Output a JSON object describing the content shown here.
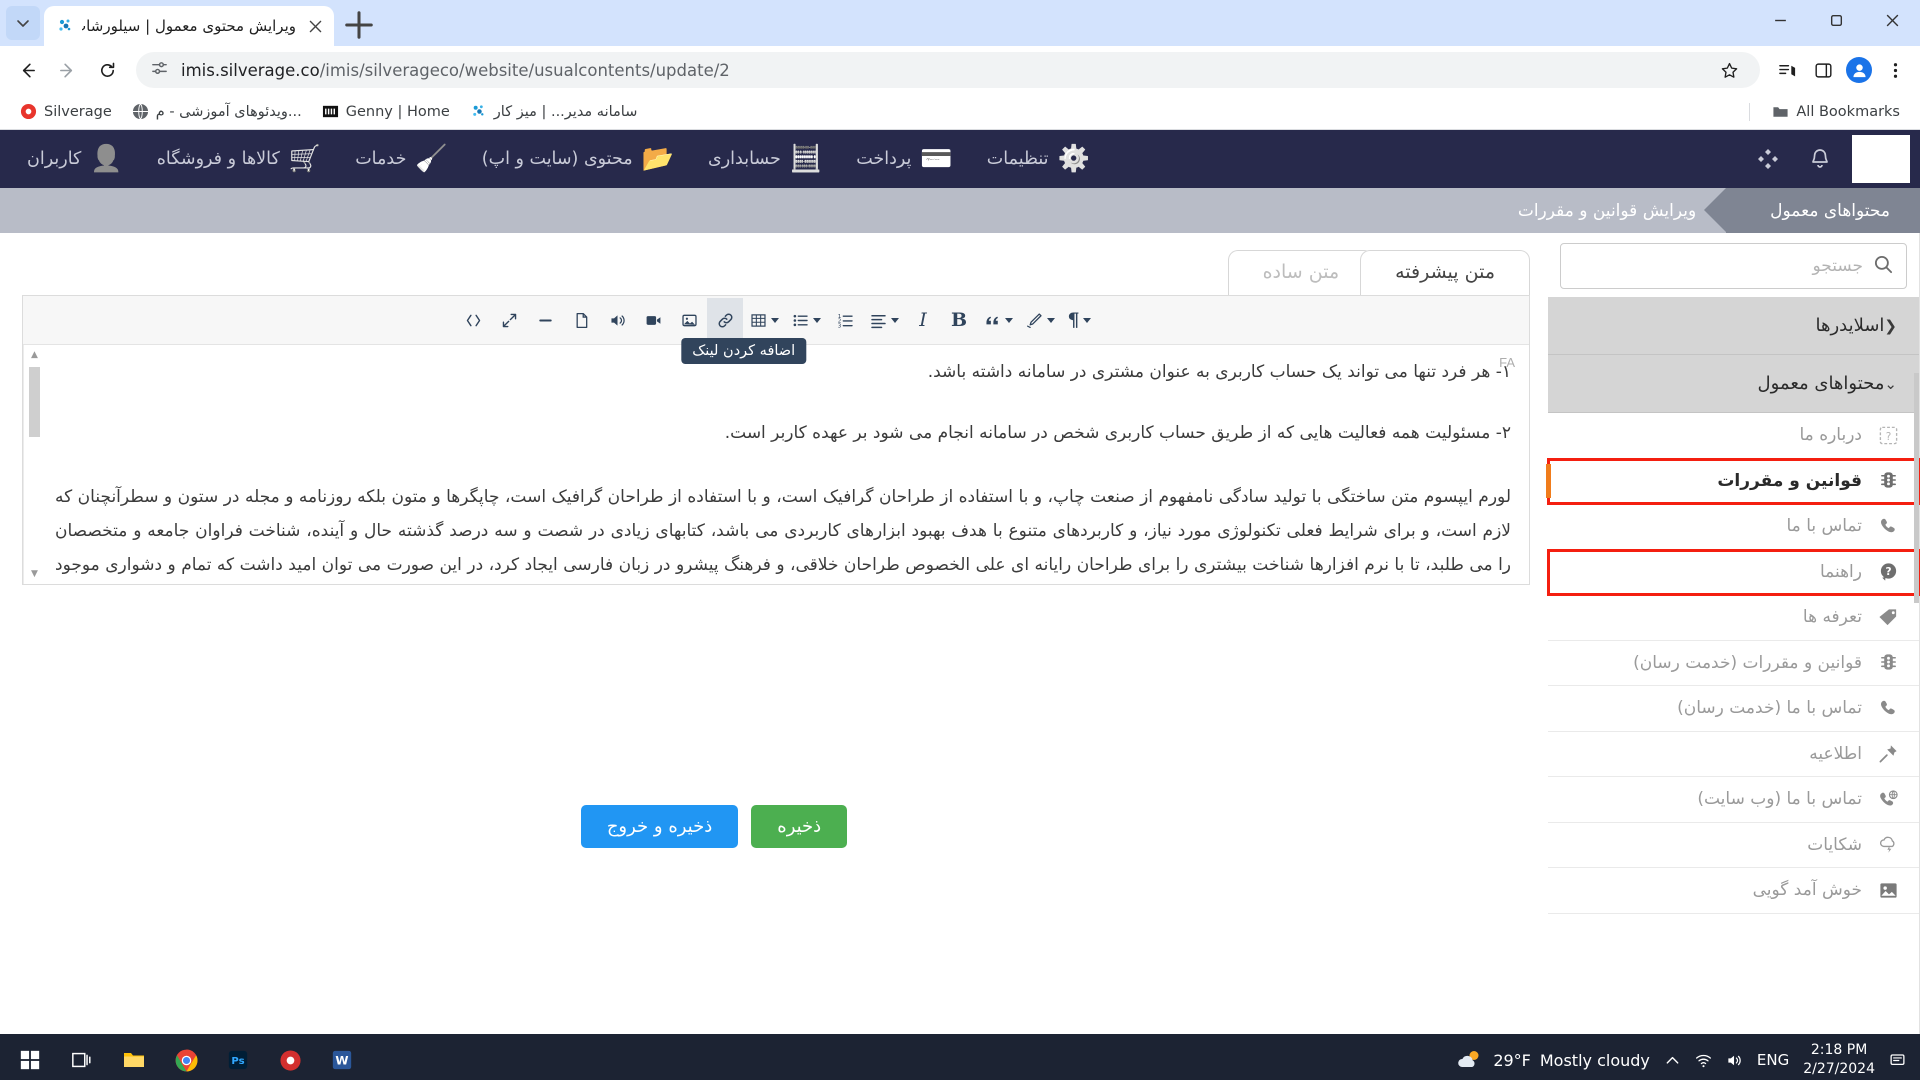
{
  "browser": {
    "tab": {
      "title": "ویرایش محتوی معمول | سیلورشاپ",
      "favicon_name": "silverage-favicon"
    },
    "new_tab_label": "+",
    "url_host": "imis.silverage.co",
    "url_path": "/imis/silverageco/website/usualcontents/update/2",
    "bookmarks": [
      {
        "label": "Silverage",
        "icon": "record-icon"
      },
      {
        "label": "ویدئوهای آموزشی - م...",
        "icon": "globe-icon"
      },
      {
        "label": "Genny | Home",
        "icon": "genny-icon"
      },
      {
        "label": "سامانه مدیر... | میز کار",
        "icon": "silverage-favicon"
      }
    ],
    "all_bookmarks_label": "All Bookmarks"
  },
  "appbar": {
    "menu": [
      {
        "label": "کاربران",
        "icon": "user-icon"
      },
      {
        "label": "کالاها و فروشگاه",
        "icon": "cart-icon"
      },
      {
        "label": "خدمات",
        "icon": "broom-icon"
      },
      {
        "label": "محتوی (سایت و اپ)",
        "icon": "folder-icon",
        "active": true
      },
      {
        "label": "حسابداری",
        "icon": "calculator-icon"
      },
      {
        "label": "پرداخت",
        "icon": "card-icon"
      },
      {
        "label": "تنظیمات",
        "icon": "gears-icon"
      }
    ],
    "bell_icon": "bell-icon",
    "apps_icon": "diamond-grid-icon"
  },
  "breadcrumbs": [
    {
      "label": "محتواهای معمول",
      "style": "dark"
    },
    {
      "label": "ویرایش قوانین و مقررات",
      "style": "light"
    }
  ],
  "editor": {
    "tabs": [
      {
        "label": "متن پیشرفته",
        "active": true
      },
      {
        "label": "متن ساده",
        "active": false
      }
    ],
    "toolbar": [
      {
        "name": "code-view-icon",
        "tooltip": ""
      },
      {
        "name": "fullscreen-icon",
        "tooltip": ""
      },
      {
        "name": "horizontal-rule-icon",
        "tooltip": ""
      },
      {
        "name": "file-icon",
        "tooltip": ""
      },
      {
        "name": "audio-icon",
        "tooltip": ""
      },
      {
        "name": "video-icon",
        "tooltip": ""
      },
      {
        "name": "image-icon",
        "tooltip": ""
      },
      {
        "name": "link-icon",
        "tooltip": "اضافه کردن لینک",
        "active": true
      },
      {
        "name": "table-icon",
        "caret": true
      },
      {
        "name": "unordered-list-icon",
        "caret": true
      },
      {
        "name": "ordered-list-icon",
        "caret": false
      },
      {
        "name": "align-icon",
        "caret": true
      },
      {
        "name": "italic-icon",
        "label": "I"
      },
      {
        "name": "bold-icon",
        "label": "B"
      },
      {
        "name": "quote-icon",
        "label": "““",
        "caret": true
      },
      {
        "name": "format-painter-icon",
        "caret": true
      },
      {
        "name": "paragraph-icon",
        "label": "¶",
        "caret": true
      }
    ],
    "lang_badge": "FA",
    "content": [
      "۱- هر فرد تنها می تواند یک حساب کاربری به عنوان مشتری در سامانه داشته باشد.",
      "۲- مسئولیت همه فعالیت هایی که از طریق حساب کاربری شخص در سامانه انجام می شود بر عهده کاربر است.",
      "لورم ایپسوم متن ساختگی با تولید سادگی نامفهوم از صنعت چاپ، و با استفاده از طراحان گرافیک است، و با استفاده از طراحان گرافیک است، چاپگرها و متون بلکه روزنامه و مجله در ستون و سطرآنچنان که لازم است، و برای شرایط فعلی تکنولوژی مورد نیاز، و کاربردهای متنوع با هدف بهبود ابزارهای کاربردی می باشد، کتابهای زیادی در شصت و سه درصد گذشته حال و آینده، شناخت فراوان جامعه و متخصصان را می طلبد، تا با نرم افزارها شناخت بیشتری را برای طراحان رایانه ای علی الخصوص طراحان خلاقی، و فرهنگ پیشرو در زبان فارسی ایجاد کرد، در این صورت می توان امید داشت که تمام و دشواری موجود در ارائه راهکارها، و شرایط"
    ]
  },
  "actions": {
    "save_label": "ذخیره",
    "save_exit_label": "ذخیره و خروج",
    "save_color": "#4caf50",
    "save_exit_color": "#2196f3"
  },
  "sidepanel": {
    "search_placeholder": "جستجو",
    "search_value": "",
    "search_icon": "search-icon",
    "groups": [
      {
        "label": "اسلایدرها",
        "chevron": "left",
        "expanded": false
      },
      {
        "label": "محتواهای معمول",
        "chevron": "down",
        "expanded": true
      }
    ],
    "items": [
      {
        "label": "درباره ما",
        "icon": "question-box-icon",
        "highlight": false
      },
      {
        "label": "قوانین و مقررات",
        "icon": "traffic-light-icon",
        "highlight": true,
        "active": true
      },
      {
        "label": "تماس با ما",
        "icon": "phone-icon",
        "highlight": false
      },
      {
        "label": "راهنما",
        "icon": "help-circle-icon",
        "highlight": true
      },
      {
        "label": "تعرفه ها",
        "icon": "tag-icon",
        "highlight": false
      },
      {
        "label": "قوانین و مقررات (خدمت رسان)",
        "icon": "traffic-light-icon",
        "highlight": false
      },
      {
        "label": "تماس با ما (خدمت رسان)",
        "icon": "phone-icon",
        "highlight": false
      },
      {
        "label": "اطلاعیه",
        "icon": "pin-icon",
        "highlight": false
      },
      {
        "label": "تماس با ما (وب سایت)",
        "icon": "phone-web-icon",
        "highlight": false
      },
      {
        "label": "شکایات",
        "icon": "cloud-bolt-icon",
        "highlight": false
      },
      {
        "label": "خوش آمد گویی",
        "icon": "image-icon",
        "highlight": false
      }
    ],
    "highlight_color": "#f41f10"
  },
  "taskbar": {
    "apps": [
      {
        "name": "start-icon"
      },
      {
        "name": "task-view-icon"
      },
      {
        "name": "file-explorer-icon"
      },
      {
        "name": "chrome-icon",
        "active": true
      },
      {
        "name": "photoshop-icon"
      },
      {
        "name": "recorder-icon"
      },
      {
        "name": "word-icon"
      }
    ],
    "weather_temp": "29°F",
    "weather_desc": "Mostly cloudy",
    "language": "ENG",
    "time": "2:18 PM",
    "date": "2/27/2024"
  }
}
